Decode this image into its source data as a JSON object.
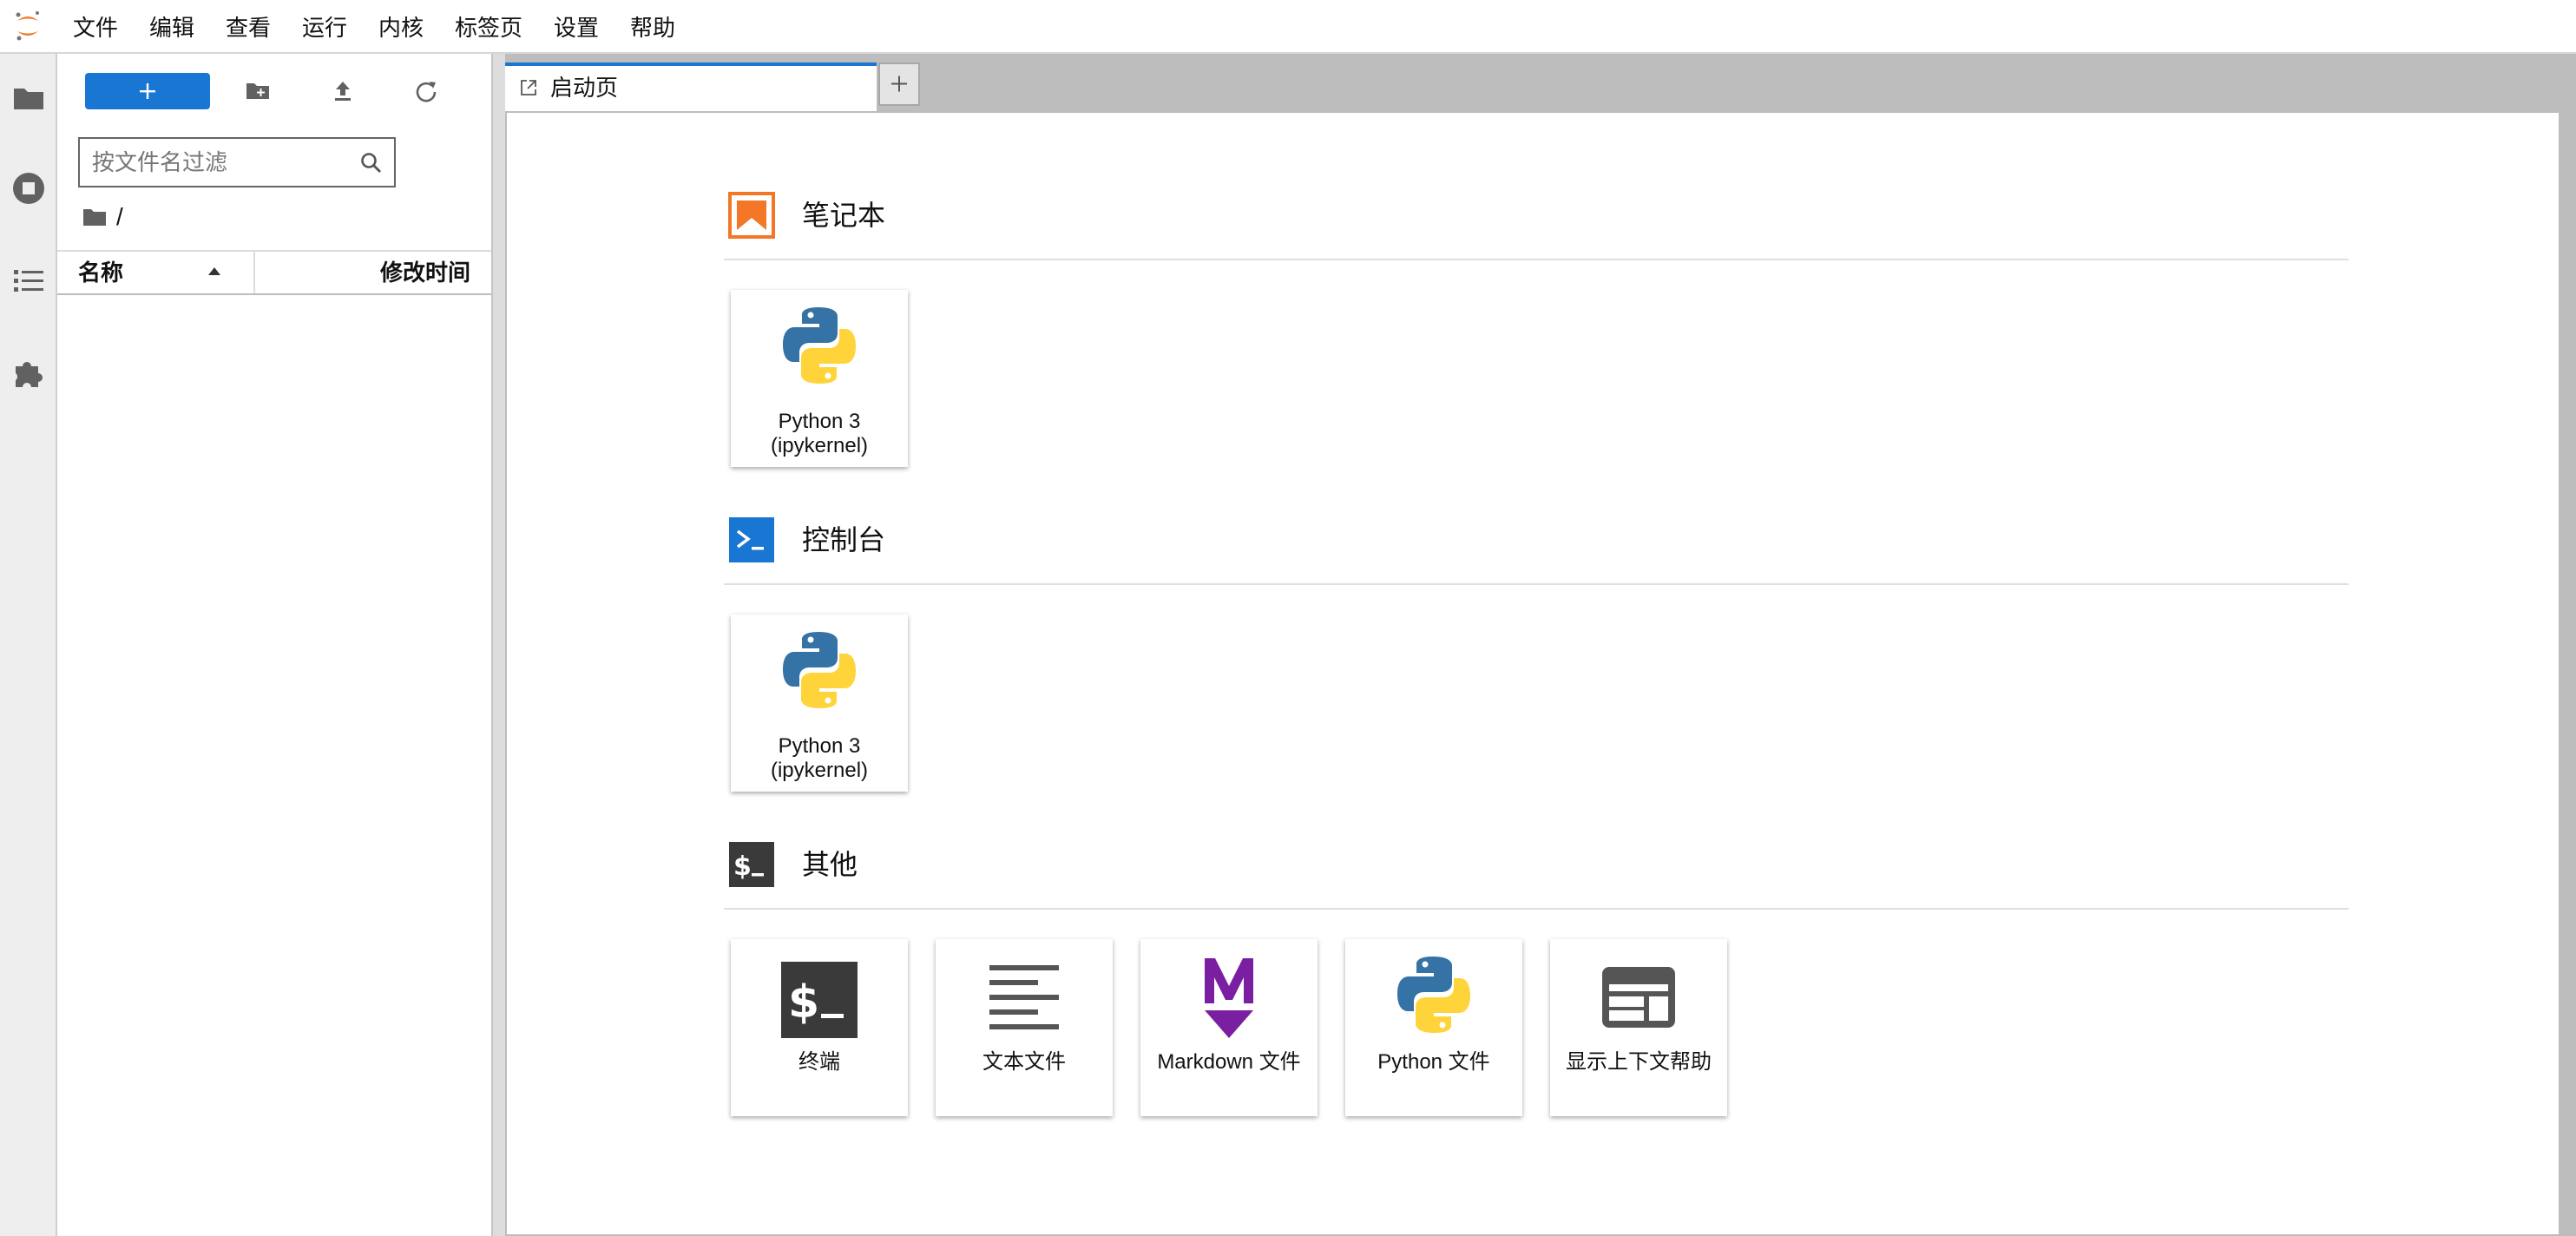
{
  "menubar": {
    "items": [
      "文件",
      "编辑",
      "查看",
      "运行",
      "内核",
      "标签页",
      "设置",
      "帮助"
    ]
  },
  "activity_bar": {
    "icons": [
      "folder-icon",
      "running-stop-icon",
      "toc-list-icon",
      "extension-puzzle-icon"
    ]
  },
  "filebrowser": {
    "toolbar": {
      "new_launcher_icon": "plus-icon",
      "new_folder_icon": "new-folder-icon",
      "upload_icon": "upload-icon",
      "refresh_icon": "refresh-icon"
    },
    "filter_placeholder": "按文件名过滤",
    "breadcrumb": "/",
    "columns": {
      "name": "名称",
      "modified": "修改时间"
    },
    "sort": "name-ascending"
  },
  "tabs": [
    {
      "label": "启动页",
      "icon": "launcher-icon",
      "active": true
    }
  ],
  "add_tab_label": "+",
  "launcher": {
    "sections": [
      {
        "title": "笔记本",
        "icon": "notebook-bookmark-icon",
        "cards": [
          {
            "label_line1": "Python 3",
            "label_line2": "(ipykernel)",
            "icon": "python-logo-icon"
          }
        ]
      },
      {
        "title": "控制台",
        "icon": "console-prompt-icon",
        "cards": [
          {
            "label_line1": "Python 3",
            "label_line2": "(ipykernel)",
            "icon": "python-logo-icon"
          }
        ]
      },
      {
        "title": "其他",
        "icon": "terminal-dollar-icon",
        "cards": [
          {
            "label": "终端",
            "icon": "terminal-icon"
          },
          {
            "label": "文本文件",
            "icon": "text-file-icon"
          },
          {
            "label": "Markdown 文件",
            "icon": "markdown-icon"
          },
          {
            "label": "Python 文件",
            "icon": "python-logo-icon"
          },
          {
            "label": "显示上下文帮助",
            "icon": "context-help-icon"
          }
        ]
      }
    ]
  },
  "colors": {
    "accent": "#1976d2",
    "notebook_orange": "#f37726",
    "markdown_purple": "#7b1fa2",
    "terminal_dark": "#3a3a3a",
    "python_blue": "#3572a5",
    "python_yellow": "#ffd43b"
  }
}
